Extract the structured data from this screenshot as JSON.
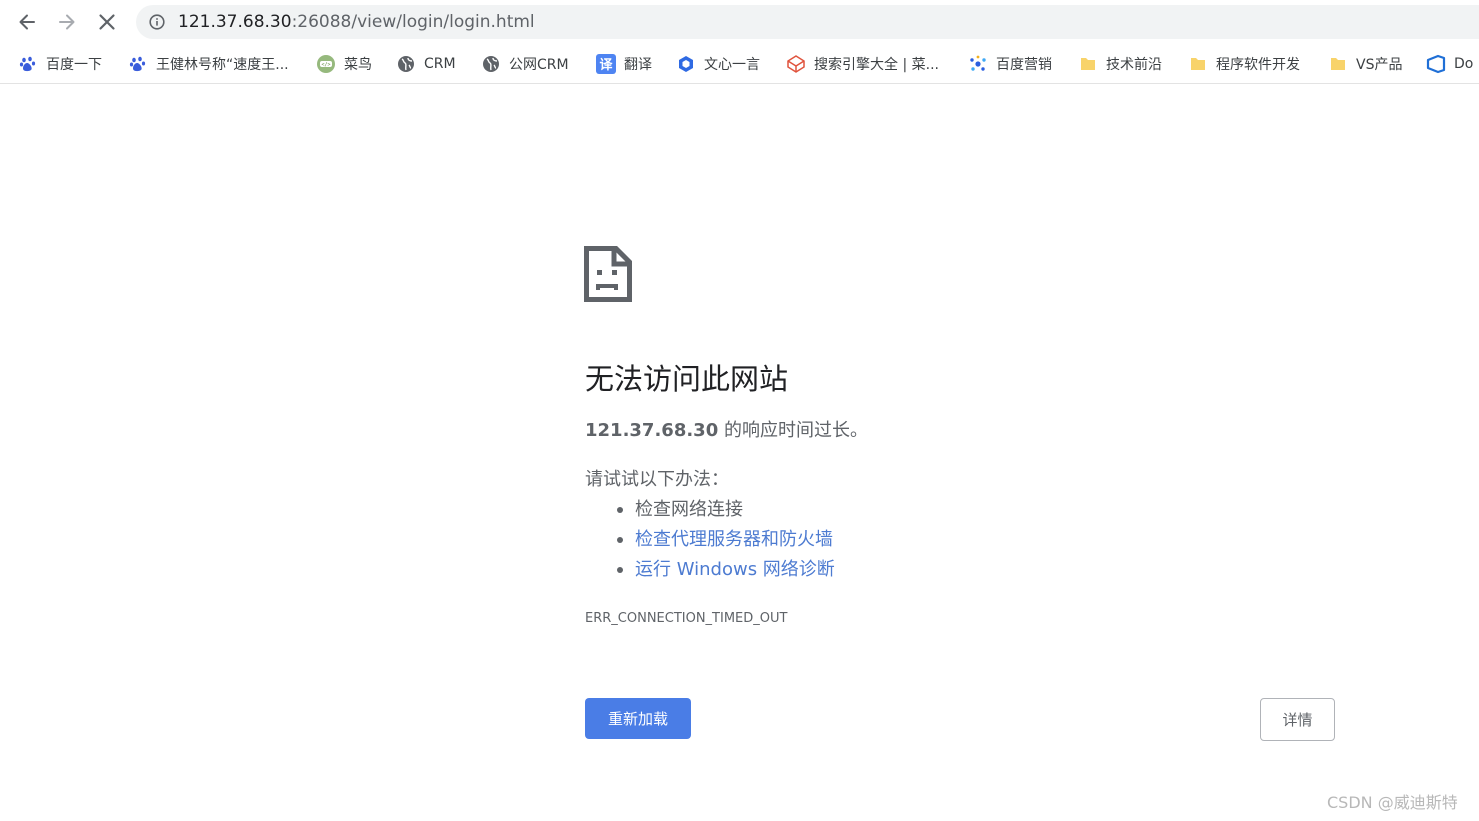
{
  "toolbar": {
    "back_icon": "arrow-left-icon",
    "forward_icon": "arrow-right-icon",
    "stop_icon": "close-icon",
    "info_icon": "info-icon",
    "url_host": "121.37.68.30",
    "url_rest": ":26088/view/login/login.html"
  },
  "bookmarks": [
    {
      "label": "百度一下",
      "icon": "baidu-paw-icon"
    },
    {
      "label": "王健林号称“速度王...",
      "icon": "baidu-paw-icon"
    },
    {
      "label": "菜鸟",
      "icon": "runoob-icon"
    },
    {
      "label": "CRM",
      "icon": "globe-icon"
    },
    {
      "label": "公网CRM",
      "icon": "globe-icon"
    },
    {
      "label": "翻译",
      "icon": "translate-icon"
    },
    {
      "label": "文心一言",
      "icon": "wenxin-icon"
    },
    {
      "label": "搜索引擎大全 | 菜...",
      "icon": "cube-icon"
    },
    {
      "label": "百度营销",
      "icon": "baidu-marketing-icon"
    },
    {
      "label": "技术前沿",
      "icon": "folder-icon"
    },
    {
      "label": "程序软件开发",
      "icon": "folder-icon"
    },
    {
      "label": "VS产品",
      "icon": "folder-icon"
    },
    {
      "label": "Do",
      "icon": "azure-devops-icon"
    }
  ],
  "error": {
    "icon": "sad-page-icon",
    "title": "无法访问此网站",
    "summary_host": "121.37.68.30",
    "summary_text": " 的响应时间过长。",
    "suggest_title": "请试试以下办法：",
    "suggestions": [
      {
        "text": "检查网络连接",
        "link": false
      },
      {
        "text": "检查代理服务器和防火墙",
        "link": true
      },
      {
        "text": "运行 Windows 网络诊断",
        "link": true
      }
    ],
    "code": "ERR_CONNECTION_TIMED_OUT",
    "reload_label": "重新加载",
    "details_label": "详情"
  },
  "watermark": "CSDN @威迪斯特",
  "colors": {
    "link": "#4d7bd1",
    "primary_button": "#4a7de6",
    "text_secondary": "#5f6368"
  }
}
